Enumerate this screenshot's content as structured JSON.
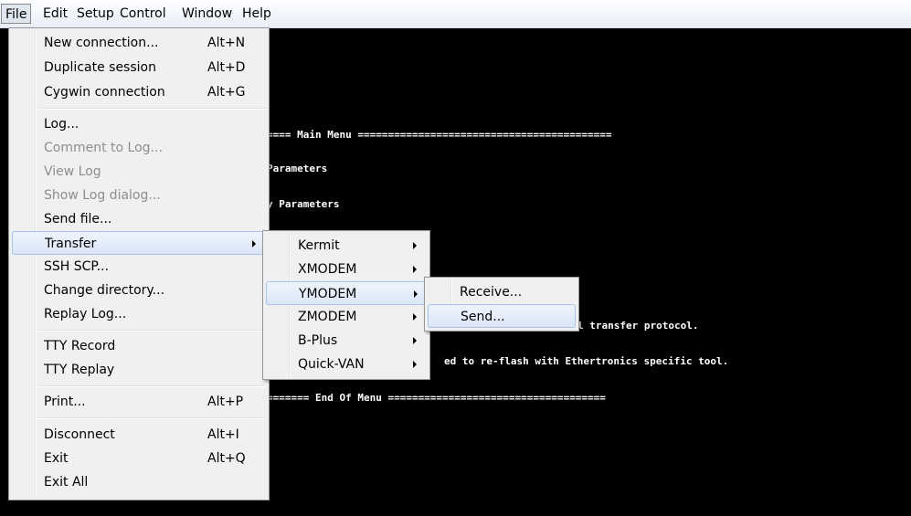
{
  "menubar": [
    "File",
    "Edit",
    "Setup",
    "Control",
    "Window",
    "Help"
  ],
  "terminal": {
    "lines": [
      "==== Main Menu ==========================================",
      "Parameters",
      "y Parameters",
      "l transfer protocol.",
      "ed to re-flash with Ethertronics specific tool.",
      "======= End Of Menu ===================================="
    ]
  },
  "file_menu": {
    "items": [
      {
        "label": "New connection...",
        "shortcut": "Alt+N"
      },
      {
        "label": "Duplicate session",
        "shortcut": "Alt+D"
      },
      {
        "label": "Cygwin connection",
        "shortcut": "Alt+G"
      },
      {
        "label": "Log..."
      },
      {
        "label": "Comment to Log...",
        "disabled": true
      },
      {
        "label": "View Log",
        "disabled": true
      },
      {
        "label": "Show Log dialog...",
        "disabled": true
      },
      {
        "label": "Send file..."
      },
      {
        "label": "Transfer",
        "submenu": true,
        "highlighted": true
      },
      {
        "label": "SSH SCP..."
      },
      {
        "label": "Change directory..."
      },
      {
        "label": "Replay Log..."
      },
      {
        "label": "TTY Record"
      },
      {
        "label": "TTY Replay"
      },
      {
        "label": "Print...",
        "shortcut": "Alt+P"
      },
      {
        "label": "Disconnect",
        "shortcut": "Alt+I"
      },
      {
        "label": "Exit",
        "shortcut": "Alt+Q"
      },
      {
        "label": "Exit All"
      }
    ]
  },
  "transfer_menu": {
    "items": [
      {
        "label": "Kermit"
      },
      {
        "label": "XMODEM"
      },
      {
        "label": "YMODEM",
        "highlighted": true
      },
      {
        "label": "ZMODEM"
      },
      {
        "label": "B-Plus"
      },
      {
        "label": "Quick-VAN"
      }
    ]
  },
  "ymodem_menu": {
    "items": [
      {
        "label": "Receive..."
      },
      {
        "label": "Send...",
        "highlighted": true
      }
    ]
  }
}
